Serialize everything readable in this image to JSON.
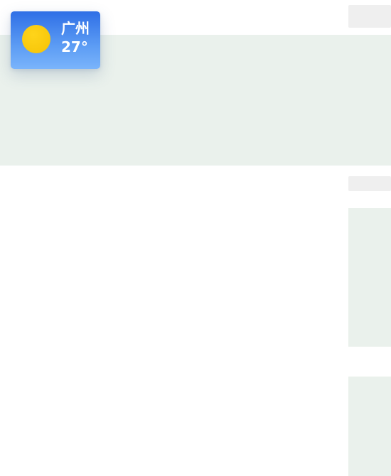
{
  "weather": {
    "city": "广州",
    "temperature": "27°",
    "icon": "sun-icon",
    "colors": {
      "card_top": "#2f6fe6",
      "card_bottom": "#7ab4fb",
      "sun": "#f8c80c",
      "text": "#ffffff"
    }
  },
  "theme": {
    "placeholder_green": "#eaf1ec",
    "placeholder_gray": "#efefef",
    "background": "#ffffff"
  }
}
